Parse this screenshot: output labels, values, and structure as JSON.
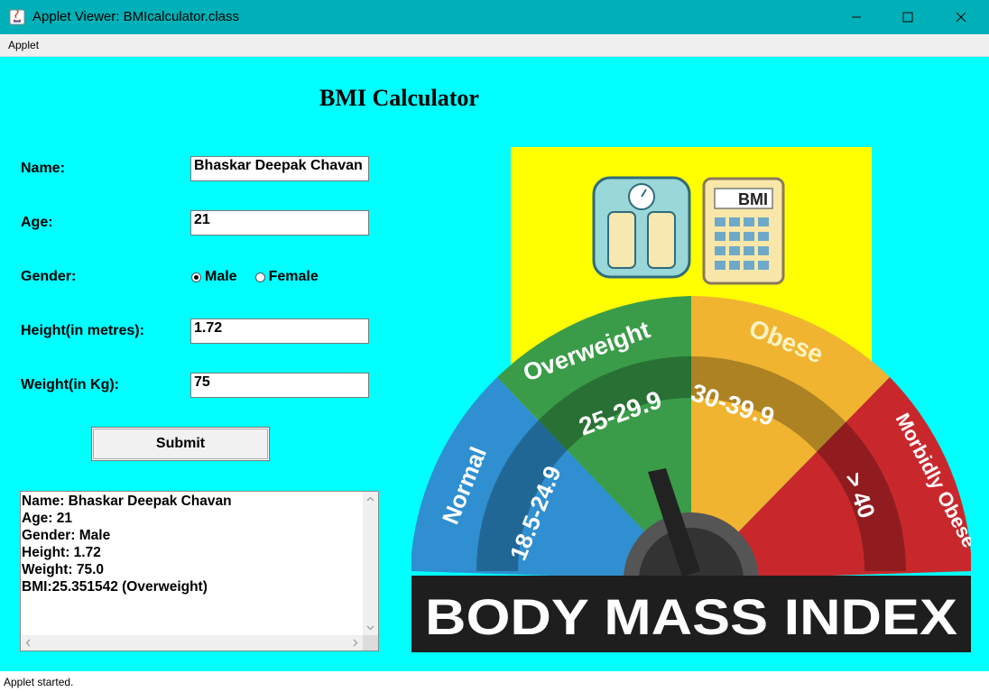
{
  "window": {
    "title": "Applet Viewer: BMIcalculator.class",
    "app_icon": "java-icon",
    "controls": [
      "minimize-icon",
      "maximize-icon",
      "close-icon"
    ]
  },
  "menubar": {
    "items": [
      "Applet"
    ]
  },
  "form": {
    "heading": "BMI Calculator",
    "name_label": "Name:",
    "name_value": "Bhaskar Deepak Chavan",
    "age_label": "Age:",
    "age_value": "21",
    "gender_label": "Gender:",
    "gender_options": [
      "Male",
      "Female"
    ],
    "gender_selected": "Male",
    "height_label": "Height(in metres):",
    "height_value": "1.72",
    "weight_label": "Weight(in Kg):",
    "weight_value": "75",
    "submit_label": "Submit"
  },
  "output": {
    "lines": [
      "Name: Bhaskar Deepak Chavan",
      "Age: 21",
      "Gender: Male",
      "Height: 1.72",
      "Weight: 75.0",
      "BMI:25.351542 (Overweight)"
    ]
  },
  "graphic": {
    "calculator_label": "BMI",
    "banner": "BODY MASS INDEX",
    "segments": [
      {
        "name": "Normal",
        "range": "18.5-24.9",
        "color": "#2f8fd0"
      },
      {
        "name": "Overweight",
        "range": "25-29.9",
        "color": "#3a9c48"
      },
      {
        "name": "Obese",
        "range": "30-39.9",
        "color": "#f0b430"
      },
      {
        "name": "Morbidly Obese",
        "range": "> 40",
        "color": "#c8282c"
      }
    ],
    "background_color": "#ffff00"
  },
  "status": {
    "text": "Applet started."
  },
  "colors": {
    "background": "#00ffff",
    "titlebar": "#00b0b8"
  }
}
